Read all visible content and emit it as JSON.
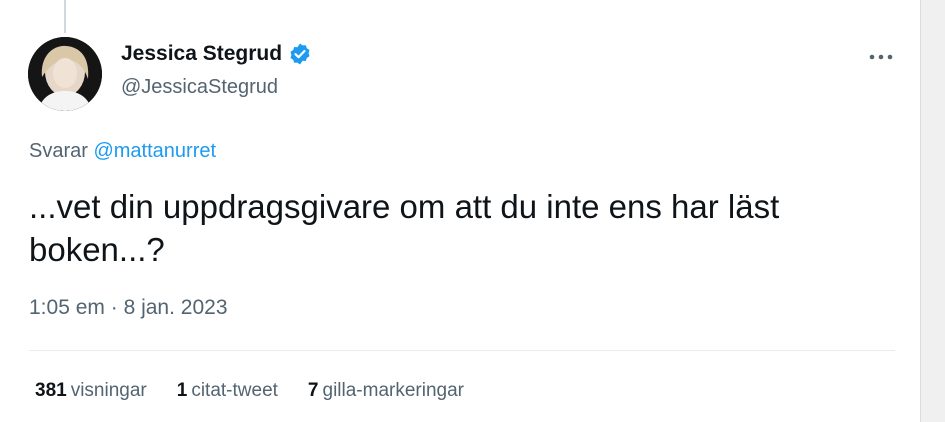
{
  "author": {
    "display_name": "Jessica Stegrud",
    "handle": "@JessicaStegrud",
    "verified": true,
    "avatar_icon": "profile-photo"
  },
  "tweet": {
    "reply_prefix": "Svarar",
    "reply_mention": "@mattanurret",
    "text": "...vet din uppdragsgivare om att du inte ens har läst boken...?",
    "time": "1:05 em",
    "separator": "·",
    "date": "8 jan. 2023"
  },
  "stats": {
    "views_count": "381",
    "views_label": "visningar",
    "quotes_count": "1",
    "quotes_label": "citat-tweet",
    "likes_count": "7",
    "likes_label": "gilla-markeringar"
  },
  "colors": {
    "accent": "#1d9bf0",
    "text_primary": "#0f1419",
    "text_secondary": "#536471"
  }
}
